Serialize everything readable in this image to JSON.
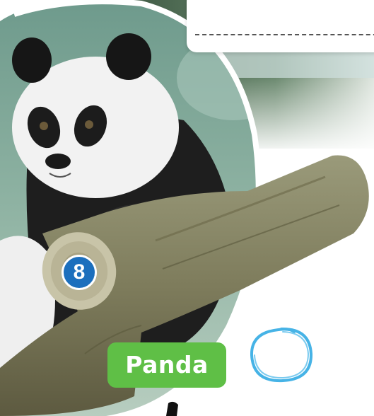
{
  "card": {
    "number": "8",
    "animal_name": "Panda"
  },
  "colors": {
    "badge_blue": "#1c6fbd",
    "label_green": "#5fbf46",
    "circle_blue": "#46b3e6"
  }
}
